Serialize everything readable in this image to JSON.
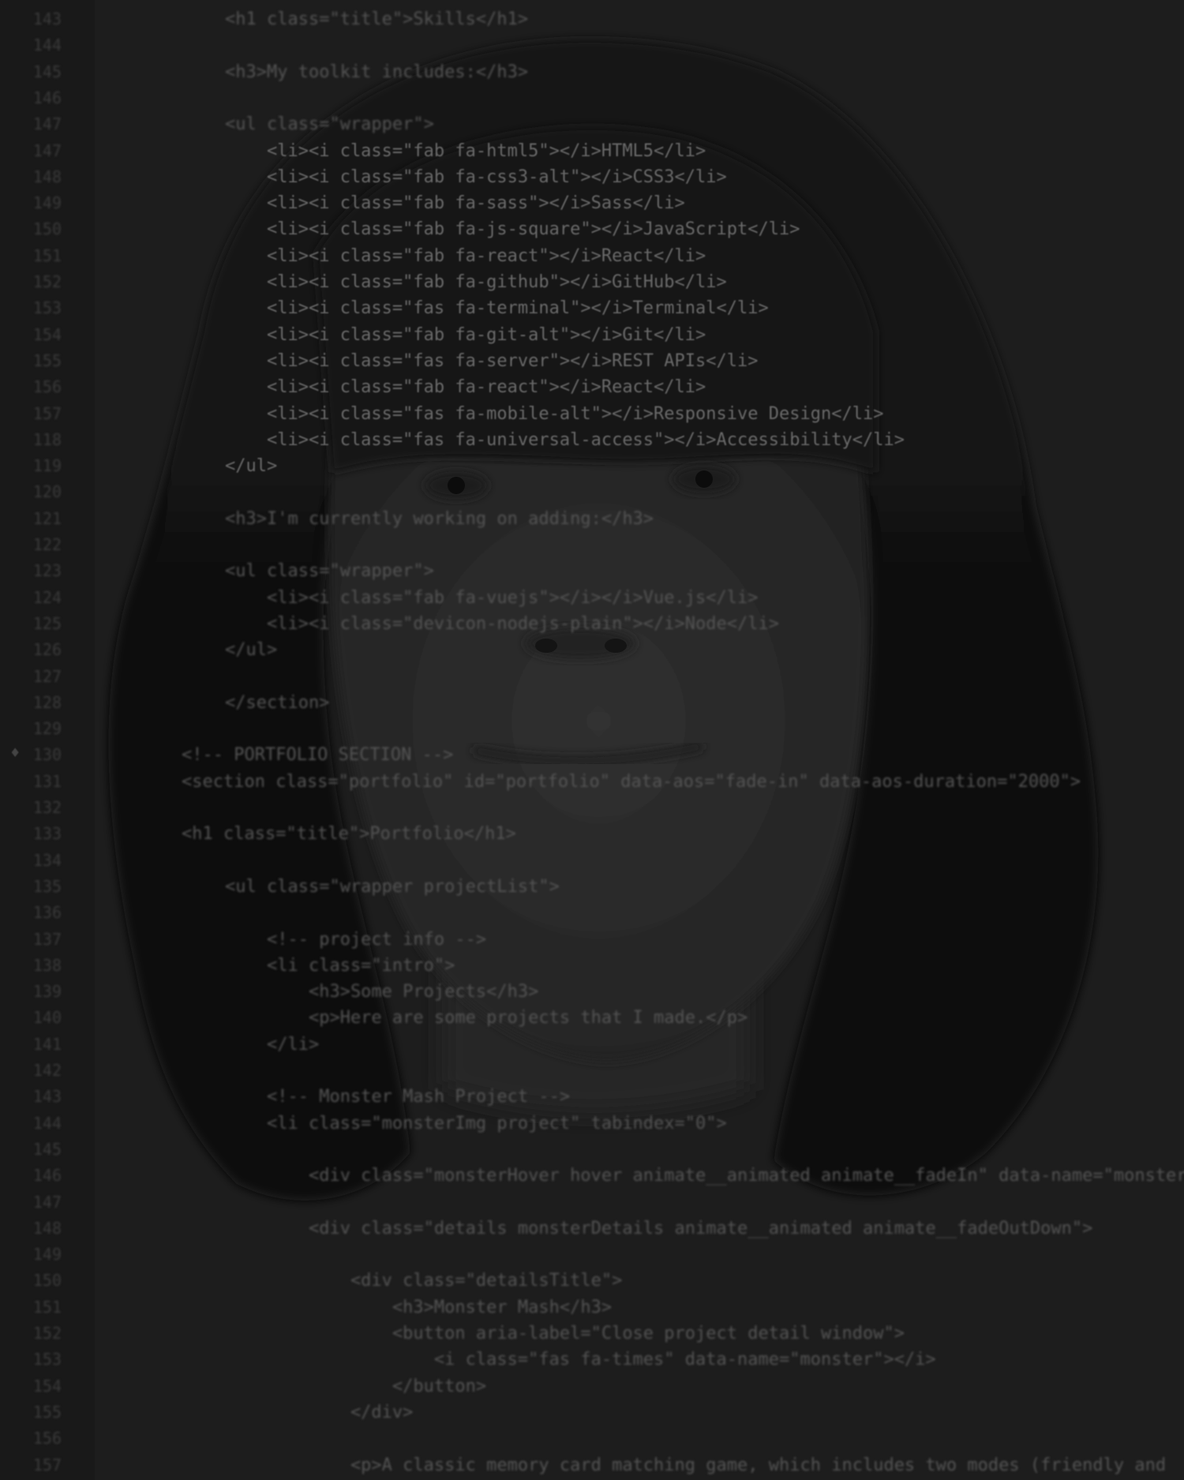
{
  "editor": {
    "lines": [
      {
        "n": "143",
        "text": "<h1 class=\"title\">Skills</h1>"
      },
      {
        "n": "144",
        "text": ""
      },
      {
        "n": "145",
        "text": "<h3>My toolkit includes:</h3>"
      },
      {
        "n": "146",
        "text": ""
      },
      {
        "n": "147",
        "text": "<ul class=\"wrapper\">"
      },
      {
        "n": "147",
        "text": "    <li><i class=\"fab fa-html5\"></i>HTML5</li>"
      },
      {
        "n": "148",
        "text": "    <li><i class=\"fab fa-css3-alt\"></i>CSS3</li>"
      },
      {
        "n": "149",
        "text": "    <li><i class=\"fab fa-sass\"></i>Sass</li>"
      },
      {
        "n": "150",
        "text": "    <li><i class=\"fab fa-js-square\"></i>JavaScript</li>"
      },
      {
        "n": "151",
        "text": "    <li><i class=\"fab fa-react\"></i>React</li>"
      },
      {
        "n": "152",
        "text": "    <li><i class=\"fab fa-github\"></i>GitHub</li>"
      },
      {
        "n": "153",
        "text": "    <li><i class=\"fas fa-terminal\"></i>Terminal</li>"
      },
      {
        "n": "154",
        "text": "    <li><i class=\"fab fa-git-alt\"></i>Git</li>"
      },
      {
        "n": "155",
        "text": "    <li><i class=\"fas fa-server\"></i>REST APIs</li>"
      },
      {
        "n": "156",
        "text": "    <li><i class=\"fab fa-react\"></i>React</li>"
      },
      {
        "n": "157",
        "text": "    <li><i class=\"fas fa-mobile-alt\"></i>Responsive Design</li>"
      },
      {
        "n": "118",
        "text": "    <li><i class=\"fas fa-universal-access\"></i>Accessibility</li>"
      },
      {
        "n": "119",
        "text": "</ul>"
      },
      {
        "n": "120",
        "text": ""
      },
      {
        "n": "121",
        "text": "<h3>I'm currently working on adding:</h3>"
      },
      {
        "n": "122",
        "text": ""
      },
      {
        "n": "123",
        "text": "<ul class=\"wrapper\">"
      },
      {
        "n": "124",
        "text": "    <li><i class=\"fab fa-vuejs\"></i></i>Vue.js</li>"
      },
      {
        "n": "125",
        "text": "    <li><i class=\"devicon-nodejs-plain\"></i>Node</li>"
      },
      {
        "n": "126",
        "text": "</ul>"
      },
      {
        "n": "127",
        "text": ""
      },
      {
        "n": "128",
        "text": "</section>"
      },
      {
        "n": "129",
        "text": ""
      },
      {
        "n": "130",
        "text": "<!-- PORTFOLIO SECTION -->"
      },
      {
        "n": "131",
        "text": "<section class=\"portfolio\" id=\"portfolio\" data-aos=\"fade-in\" data-aos-duration=\"2000\">"
      },
      {
        "n": "132",
        "text": ""
      },
      {
        "n": "133",
        "text": "<h1 class=\"title\">Portfolio</h1>"
      },
      {
        "n": "134",
        "text": ""
      },
      {
        "n": "135",
        "text": "<ul class=\"wrapper projectList\">"
      },
      {
        "n": "136",
        "text": ""
      },
      {
        "n": "137",
        "text": "    <!-- project info -->"
      },
      {
        "n": "138",
        "text": "    <li class=\"intro\">"
      },
      {
        "n": "139",
        "text": "        <h3>Some Projects</h3>"
      },
      {
        "n": "140",
        "text": "        <p>Here are some projects that I made.</p>"
      },
      {
        "n": "141",
        "text": "    </li>"
      },
      {
        "n": "142",
        "text": ""
      },
      {
        "n": "143",
        "text": "    <!-- Monster Mash Project -->"
      },
      {
        "n": "144",
        "text": "    <li class=\"monsterImg project\" tabindex=\"0\">"
      },
      {
        "n": "145",
        "text": ""
      },
      {
        "n": "146",
        "text": "        <div class=\"monsterHover hover animate__animated animate__fadeIn\" data-name=\"monster\">"
      },
      {
        "n": "147",
        "text": ""
      },
      {
        "n": "148",
        "text": "        <div class=\"details monsterDetails animate__animated animate__fadeOutDown\">"
      },
      {
        "n": "149",
        "text": ""
      },
      {
        "n": "150",
        "text": "            <div class=\"detailsTitle\">"
      },
      {
        "n": "151",
        "text": "                <h3>Monster Mash</h3>"
      },
      {
        "n": "152",
        "text": "                <button aria-label=\"Close project detail window\">"
      },
      {
        "n": "153",
        "text": "                    <i class=\"fas fa-times\" data-name=\"monster\"></i>"
      },
      {
        "n": "154",
        "text": "                </button>"
      },
      {
        "n": "155",
        "text": "            </div>"
      },
      {
        "n": "156",
        "text": ""
      },
      {
        "n": "157",
        "text": "            <p>A classic memory card matching game, which includes two modes (friendly and"
      }
    ]
  },
  "colors": {
    "background": "#1d1d1d",
    "code_text": "#555555",
    "hair": "#0f0f0f",
    "skin": "#2c2c2c"
  }
}
